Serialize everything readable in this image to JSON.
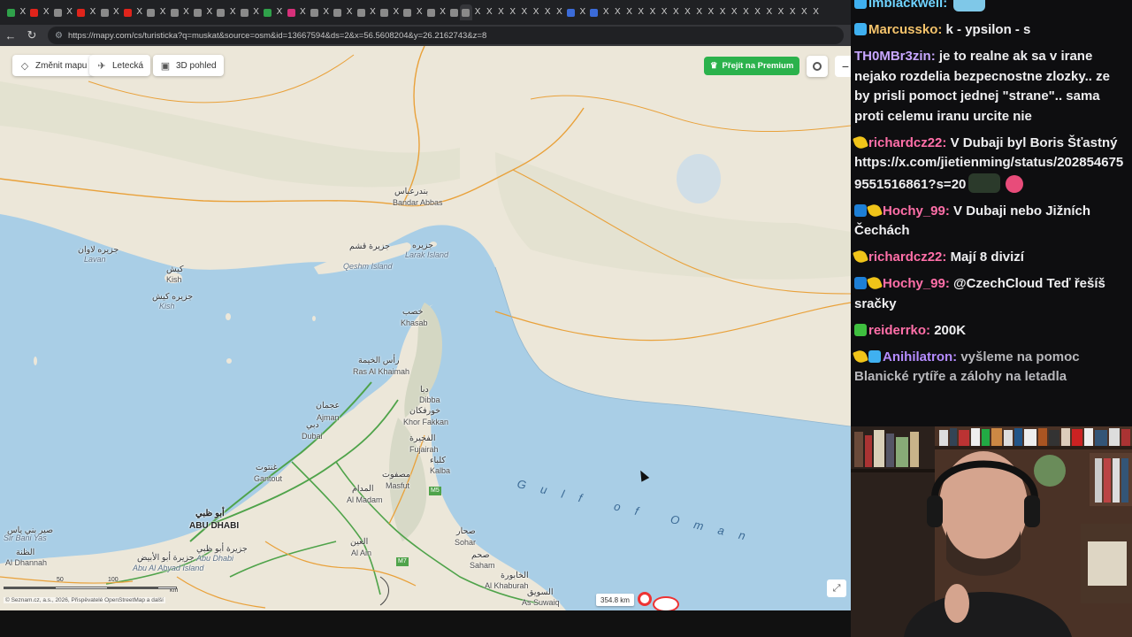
{
  "browser": {
    "url": "https://mapy.com/cs/turisticka?q=muskat&source=osm&id=13667594&ds=2&x=56.5608204&y=26.2162743&z=8",
    "tabs": [
      {
        "kind": "gr"
      },
      {
        "kind": "x"
      },
      {
        "kind": "yt"
      },
      {
        "kind": "x"
      },
      {
        "kind": "gen"
      },
      {
        "kind": "x"
      },
      {
        "kind": "yt"
      },
      {
        "kind": "x"
      },
      {
        "kind": "gen"
      },
      {
        "kind": "x"
      },
      {
        "kind": "yt"
      },
      {
        "kind": "x"
      },
      {
        "kind": "gen"
      },
      {
        "kind": "x"
      },
      {
        "kind": "gen"
      },
      {
        "kind": "x"
      },
      {
        "kind": "gen"
      },
      {
        "kind": "x"
      },
      {
        "kind": "gen"
      },
      {
        "kind": "x"
      },
      {
        "kind": "gen"
      },
      {
        "kind": "x"
      },
      {
        "kind": "gr"
      },
      {
        "kind": "x"
      },
      {
        "kind": "pk"
      },
      {
        "kind": "x"
      },
      {
        "kind": "gen"
      },
      {
        "kind": "x"
      },
      {
        "kind": "gen"
      },
      {
        "kind": "x"
      },
      {
        "kind": "gen"
      },
      {
        "kind": "x"
      },
      {
        "kind": "gen"
      },
      {
        "kind": "x"
      },
      {
        "kind": "gen"
      },
      {
        "kind": "x"
      },
      {
        "kind": "gen"
      },
      {
        "kind": "x"
      },
      {
        "kind": "gen"
      },
      {
        "kind": "active"
      },
      {
        "kind": "x"
      },
      {
        "kind": "x"
      },
      {
        "kind": "x"
      },
      {
        "kind": "x"
      },
      {
        "kind": "x"
      },
      {
        "kind": "x"
      },
      {
        "kind": "x"
      },
      {
        "kind": "x"
      },
      {
        "kind": "bl"
      },
      {
        "kind": "x"
      },
      {
        "kind": "bl"
      },
      {
        "kind": "x"
      },
      {
        "kind": "x"
      },
      {
        "kind": "x"
      },
      {
        "kind": "x"
      },
      {
        "kind": "x"
      },
      {
        "kind": "x"
      },
      {
        "kind": "x"
      },
      {
        "kind": "x"
      },
      {
        "kind": "x"
      },
      {
        "kind": "x"
      },
      {
        "kind": "x"
      },
      {
        "kind": "x"
      },
      {
        "kind": "x"
      },
      {
        "kind": "x"
      },
      {
        "kind": "x"
      },
      {
        "kind": "x"
      },
      {
        "kind": "x"
      },
      {
        "kind": "x"
      },
      {
        "kind": "x"
      }
    ]
  },
  "map": {
    "controls": {
      "change_map": "Změnit mapu",
      "aerial": "Letecká",
      "view3d": "3D pohled",
      "premium": "Přejít na Premium"
    },
    "distance": "354.8 km",
    "copyright": "© Seznam.cz, a.s., 2026, Přispěvatelé OpenStreetMap a další",
    "scale": {
      "a": "0",
      "b": "50",
      "c": "100",
      "unit": "km"
    },
    "labels": {
      "bandar_abbas_ar": "بندرعباس",
      "bandar_abbas": "Bandar Abbas",
      "qeshm_ar": "جزيرة قشم",
      "qeshm": "Qeshm Island",
      "larak_ar": "جزيره",
      "larak": "Larak Island",
      "lavan_ar": "جزيره لاوان",
      "lavan": "Lavan",
      "kish_ar": "كيش",
      "kish": "Kish",
      "kish2_ar": "جزيره كيش",
      "kish2": "Kish",
      "khasab_ar": "خصب",
      "khasab": "Khasab",
      "rak_ar": "رأس الخيمة",
      "rak": "Ras Al Khaimah",
      "dibba_ar": "دبا",
      "dibba": "Dibba",
      "khorfakkan_ar": "خورفكان",
      "khorfakkan": "Khor Fakkan",
      "fujairah_ar": "الفجيرة",
      "fujairah": "Fujairah",
      "kalba_ar": "كلباء",
      "kalba": "Kalba",
      "ajman_ar": "عجمان",
      "ajman": "Ajman",
      "dubai_ar": "دبي",
      "dubai": "Dubai",
      "ghantoot_ar": "غنتوت",
      "ghantoot": "Gantout",
      "masfut_ar": "مصفوت",
      "masfut": "Masfut",
      "aldadam_ar": "المدام",
      "aldadam": "Al Madam",
      "abudhabi_ar": "أبو ظبي",
      "abudhabi": "ABU DHABI",
      "abudhabi2_ar": "جزيرة أبو ظبي",
      "abudhabi2": "Abu Dhabi",
      "sirbaniyas_ar": "صير بني ياس",
      "sirbaniyas": "Sir Bani Yas",
      "aldhannah_ar": "الظنة",
      "aldhannah": "Al Dhannah",
      "abualabyad_ar": "جزيرة أبو الأبيض",
      "abualabyad": "Abu Al Abyad Island",
      "alain_ar": "العين",
      "alain": "Al Ain",
      "sohar_ar": "صحار",
      "sohar": "Sohar",
      "saham_ar": "صحم",
      "saham": "Saham",
      "khaburah_ar": "الخابورة",
      "khaburah": "Al Khaburah",
      "suwaiq_ar": "السويق",
      "suwaiq": "As Suwaiq",
      "gulf": "Gulf of Oman",
      "m5": "M5",
      "m7": "M7"
    },
    "colors": {
      "land": "#ece7d9",
      "sea": "#a7cde6",
      "road": "#e9a13a",
      "motorway": "#4fa34a"
    }
  },
  "taskbar": {
    "icons": [
      "windows-start-icon",
      "file-explorer-icon",
      "edge-icon",
      "obs-icon",
      "spotify-icon",
      "notepad-icon",
      "discord-icon"
    ]
  },
  "chat": {
    "messages": [
      {
        "user": "imblackwell",
        "color": "#6fd3ff",
        "badges": [
          "cube"
        ],
        "text": "",
        "emote": "blue",
        "partial": true
      },
      {
        "user": "Marcussko",
        "color": "#f4c36b",
        "badges": [
          "cube"
        ],
        "text": "k - ypsilon - s"
      },
      {
        "user": "TH0MBr3zin",
        "color": "#c8a7ff",
        "badges": [],
        "text": "je to realne ak sa v irane nejako rozdelia bezpecnostne zlozky.. ze by prisli pomoct jednej \"strane\".. sama proti celemu iranu urcite nie"
      },
      {
        "user": "richardcz22",
        "color": "#ff6fa8",
        "badges": [
          "sub"
        ],
        "text": "V Dubaji byl Boris Šťastný https://x.com/jietienming/status/2028546759551516861?s=20",
        "emote": "dark",
        "heart": true
      },
      {
        "user": "Hochy_99",
        "color": "#ff6fa8",
        "badges": [
          "boost",
          "sub"
        ],
        "text": "V Dubaji nebo Jižních Čechách"
      },
      {
        "user": "richardcz22",
        "color": "#ff6fa8",
        "badges": [
          "sub"
        ],
        "text": "Mají 8 divizí"
      },
      {
        "user": "Hochy_99",
        "color": "#ff6fa8",
        "badges": [
          "boost",
          "sub"
        ],
        "text": "@CzechCloud Teď řešíš sračky"
      },
      {
        "user": "reiderrko",
        "color": "#ff6fa8",
        "badges": [
          "green"
        ],
        "text": "200K"
      },
      {
        "user": "Anihilatron",
        "color": "#b58cff",
        "badges": [
          "sub",
          "cube"
        ],
        "text": "vyšleme na pomoc Blanické rytíře a zálohy na letadla",
        "dim": true
      }
    ]
  }
}
